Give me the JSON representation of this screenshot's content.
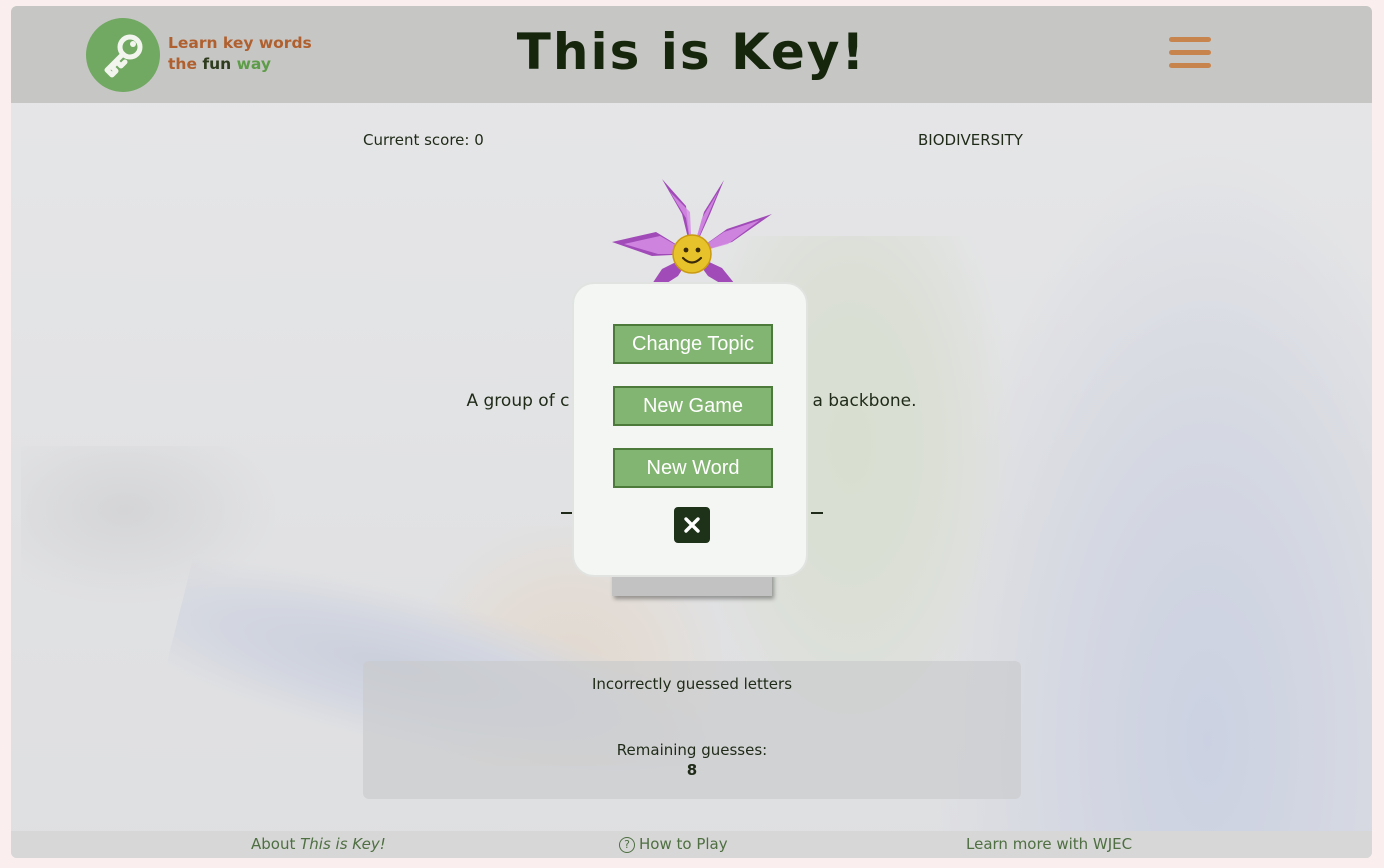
{
  "header": {
    "title": "This is Key!",
    "tagline": {
      "line1": "Learn key words",
      "line2_the": "the",
      "line2_fun": "fun",
      "line2_way": "way"
    },
    "logo_icon": "key-icon",
    "menu_icon": "hamburger-menu-icon"
  },
  "game": {
    "score_label": "Current score: 0",
    "topic": "BIODIVERSITY",
    "mascot_icon": "smiling-flower-icon",
    "clue_left": "A group of c",
    "clue_right": "a backbone.",
    "incorrect_label": "Incorrectly guessed letters",
    "remaining_label": "Remaining guesses:",
    "remaining_count": "8"
  },
  "modal": {
    "change_topic": "Change Topic",
    "new_game": "New Game",
    "new_word": "New Word",
    "close_icon": "close-icon"
  },
  "footer": {
    "about_prefix": "About ",
    "about_title": "This is Key!",
    "how_to_play": "How to Play",
    "learn_more": "Learn more with WJEC"
  },
  "colors": {
    "header_bg": "#c6c6c4",
    "logo_green": "#71a862",
    "menu_orange": "#c8844d",
    "button_green": "#82b571",
    "close_dark": "#1d3218",
    "title_dark": "#16260d"
  }
}
